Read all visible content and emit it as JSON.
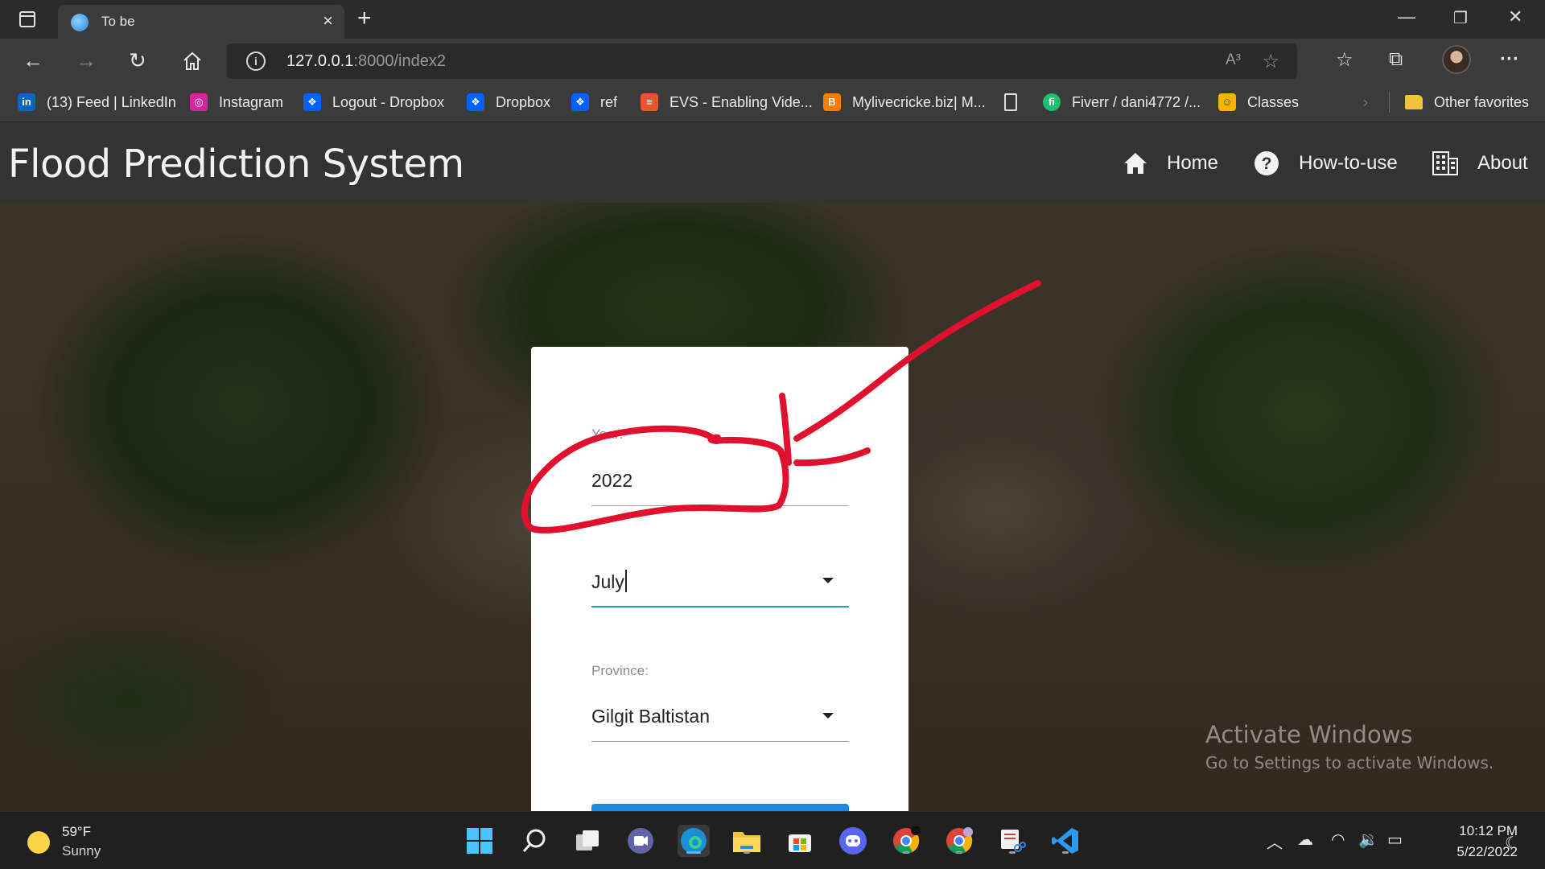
{
  "browser": {
    "tab_title": "To be",
    "url_host": "127.0.0.1",
    "url_path": ":8000/index2",
    "read_aloud_label": "A³",
    "bookmarks": [
      {
        "label": "(13) Feed | LinkedIn",
        "icon": "linkedin-icon",
        "color": "#0a66c2",
        "glyph": "in"
      },
      {
        "label": "Instagram",
        "icon": "instagram-icon",
        "color": "#d6249f",
        "glyph": "◎"
      },
      {
        "label": "Logout - Dropbox",
        "icon": "dropbox-icon",
        "color": "#0061ff",
        "glyph": "❖"
      },
      {
        "label": "Dropbox",
        "icon": "dropbox-icon",
        "color": "#0061ff",
        "glyph": "❖"
      },
      {
        "label": "ref",
        "icon": "dropbox-icon",
        "color": "#0061ff",
        "glyph": "❖"
      },
      {
        "label": "EVS - Enabling Vide...",
        "icon": "evs-icon",
        "color": "#e8542d",
        "glyph": "≡"
      },
      {
        "label": "Mylivecricke.biz| M...",
        "icon": "blogger-icon",
        "color": "#f57d00",
        "glyph": "B"
      },
      {
        "label": "",
        "icon": "document-icon",
        "color": "#3b3b3b",
        "glyph": "▯"
      },
      {
        "label": "Fiverr / dani4772 /...",
        "icon": "fiverr-icon",
        "color": "#1dbf73",
        "glyph": "fi"
      },
      {
        "label": "Classes",
        "icon": "classroom-icon",
        "color": "#f4b400",
        "glyph": "☺"
      }
    ],
    "other_favorites": "Other favorites",
    "colors": {
      "chrome_dark": "#2b2b2b",
      "chrome": "#3b3b3b"
    }
  },
  "site": {
    "title": "Flood Prediction System",
    "nav": [
      {
        "label": "Home",
        "icon": "home-icon"
      },
      {
        "label": "How-to-use",
        "icon": "help-circle-icon"
      },
      {
        "label": "About",
        "icon": "building-icon"
      }
    ],
    "header_color": "#333333"
  },
  "form": {
    "year_label": "Year:",
    "year_value": "2022",
    "month_value": "July",
    "province_label": "Province:",
    "province_value": "Gilgit Baltistan",
    "accent_color": "#26a69a",
    "button_color": "#1e88e5"
  },
  "watermark": {
    "title": "Activate Windows",
    "subtitle": "Go to Settings to activate Windows."
  },
  "taskbar": {
    "temperature": "59°F",
    "condition": "Sunny",
    "apps": [
      "windows-start-icon",
      "search-icon",
      "task-view-icon",
      "teams-chat-icon",
      "edge-icon",
      "file-explorer-icon",
      "microsoft-store-icon",
      "discord-icon",
      "chrome-icon",
      "chrome-profile-icon",
      "snipping-tool-icon",
      "vscode-icon"
    ],
    "time": "10:12 PM",
    "date": "5/22/2022"
  },
  "annotation": {
    "color": "#e0102f"
  }
}
